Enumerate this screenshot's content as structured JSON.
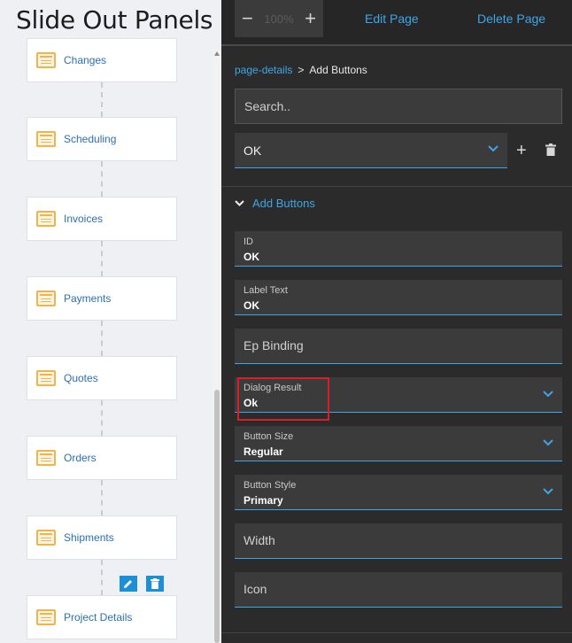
{
  "left": {
    "title": "Slide Out Panels",
    "nodes": [
      {
        "label": "Changes"
      },
      {
        "label": "Scheduling"
      },
      {
        "label": "Invoices"
      },
      {
        "label": "Payments"
      },
      {
        "label": "Quotes"
      },
      {
        "label": "Orders"
      },
      {
        "label": "Shipments"
      },
      {
        "label": "Project Details"
      }
    ]
  },
  "toolbar": {
    "zoom_minus": "−",
    "zoom_value": "100%",
    "zoom_plus": "+",
    "edit_page": "Edit Page",
    "delete_page": "Delete Page"
  },
  "breadcrumb": {
    "parent": "page-details",
    "separator": ">",
    "current": "Add Buttons"
  },
  "search": {
    "placeholder": "Search.."
  },
  "selector": {
    "value": "OK",
    "add_label": "+"
  },
  "section": {
    "title": "Add Buttons"
  },
  "fields": {
    "id": {
      "label": "ID",
      "value": "OK"
    },
    "label_text": {
      "label": "Label Text",
      "value": "OK"
    },
    "ep_binding": {
      "placeholder": "Ep Binding"
    },
    "dialog_result": {
      "label": "Dialog Result",
      "value": "Ok"
    },
    "button_size": {
      "label": "Button Size",
      "value": "Regular"
    },
    "button_style": {
      "label": "Button Style",
      "value": "Primary"
    },
    "width": {
      "placeholder": "Width"
    },
    "icon": {
      "placeholder": "Icon"
    }
  },
  "colors": {
    "accent": "#3ea6e8",
    "panel_bg": "#2b2b2b",
    "field_bg": "#3b3b3b",
    "highlight": "#d51f2a",
    "node_icon": "#f2b34a"
  }
}
